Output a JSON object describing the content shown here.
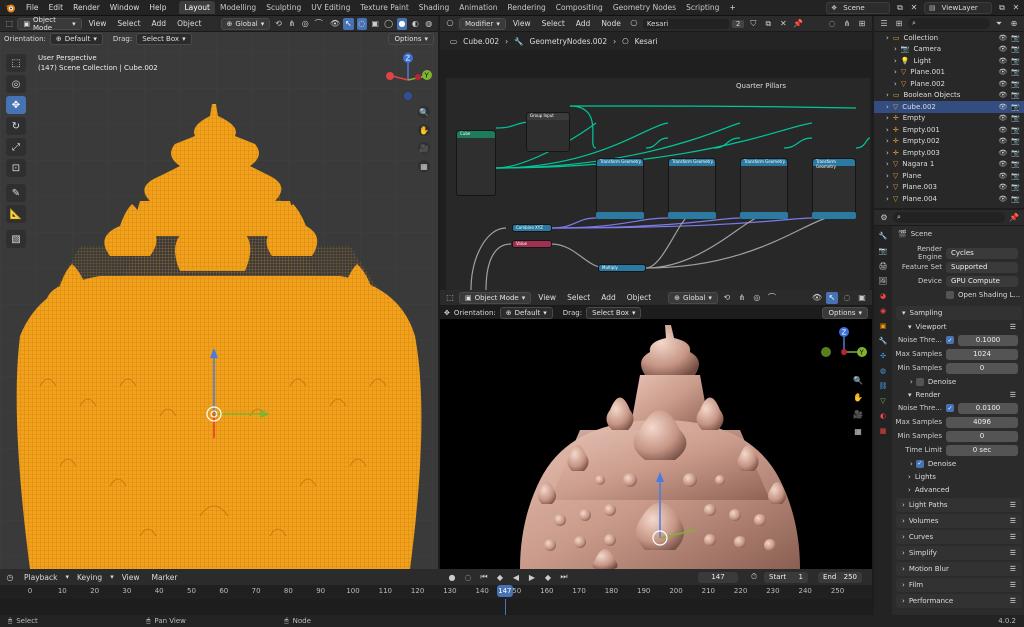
{
  "topbar": {
    "menus": [
      "File",
      "Edit",
      "Render",
      "Window",
      "Help"
    ],
    "workspaces": [
      "Layout",
      "Modelling",
      "Sculpting",
      "UV Editing",
      "Texture Paint",
      "Shading",
      "Animation",
      "Rendering",
      "Compositing",
      "Geometry Nodes",
      "Scripting"
    ],
    "add_tab": "+",
    "scene": "Scene",
    "view_layer": "ViewLayer"
  },
  "viewport1": {
    "mode": "Object Mode",
    "menus": [
      "View",
      "Select",
      "Add",
      "Object"
    ],
    "transform": "Global",
    "orientation_label": "Orientation:",
    "orientation_value": "Default",
    "drag_label": "Drag:",
    "drag_value": "Select Box",
    "options": "Options",
    "overlay_title": "User Perspective",
    "overlay_sub": "(147) Scene Collection | Cube.002"
  },
  "node_editor": {
    "editor": "Modifier",
    "menus": [
      "View",
      "Select",
      "Add",
      "Node"
    ],
    "tree_name": "Kesari",
    "users": "2",
    "crumbs": [
      "Cube.002",
      "GeometryNodes.002",
      "Kesari"
    ],
    "frame_label": "Quarter Pillars",
    "nodes": {
      "group_input": "Group Input",
      "cube": "Cube",
      "transform": "Transform Geometry",
      "combine": "Combine XYZ",
      "value": "Value",
      "multiply": "Multiply"
    }
  },
  "viewport2": {
    "mode": "Object Mode",
    "menus": [
      "View",
      "Select",
      "Add",
      "Object"
    ],
    "transform": "Global",
    "orientation_label": "Orientation:",
    "orientation_value": "Default",
    "drag_label": "Drag:",
    "drag_value": "Select Box",
    "options": "Options"
  },
  "outliner": {
    "rows": [
      {
        "name": "Collection",
        "indent": 1,
        "selected": false
      },
      {
        "name": "Camera",
        "indent": 2,
        "selected": false
      },
      {
        "name": "Light",
        "indent": 2,
        "selected": false
      },
      {
        "name": "Plane.001",
        "indent": 2,
        "selected": false
      },
      {
        "name": "Plane.002",
        "indent": 2,
        "selected": false
      },
      {
        "name": "Boolean Objects",
        "indent": 1,
        "selected": false
      },
      {
        "name": "Cube.002",
        "indent": 1,
        "selected": true
      },
      {
        "name": "Empty",
        "indent": 1,
        "selected": false
      },
      {
        "name": "Empty.001",
        "indent": 1,
        "selected": false
      },
      {
        "name": "Empty.002",
        "indent": 1,
        "selected": false
      },
      {
        "name": "Empty.003",
        "indent": 1,
        "selected": false
      },
      {
        "name": "Nagara 1",
        "indent": 1,
        "selected": false
      },
      {
        "name": "Plane",
        "indent": 1,
        "selected": false
      },
      {
        "name": "Plane.003",
        "indent": 1,
        "selected": false
      },
      {
        "name": "Plane.004",
        "indent": 1,
        "selected": false
      }
    ]
  },
  "properties": {
    "scene": "Scene",
    "render_engine_label": "Render Engine",
    "render_engine": "Cycles",
    "feature_set_label": "Feature Set",
    "feature_set": "Supported",
    "device_label": "Device",
    "device": "GPU Compute",
    "osl_label": "Open Shading L...",
    "sampling": "Sampling",
    "viewport": "Viewport",
    "noise_threshold_label": "Noise Thre...",
    "viewport_noise": "0.1000",
    "max_samples_label": "Max Samples",
    "viewport_max": "1024",
    "min_samples_label": "Min Samples",
    "viewport_min": "0",
    "denoise": "Denoise",
    "render": "Render",
    "render_noise": "0.0100",
    "render_max": "4096",
    "render_min": "0",
    "time_limit_label": "Time Limit",
    "time_limit": "0 sec",
    "render_denoise": "Denoise",
    "lights": "Lights",
    "advanced": "Advanced",
    "panels": [
      "Light Paths",
      "Volumes",
      "Curves",
      "Simplify",
      "Motion Blur",
      "Film",
      "Performance"
    ]
  },
  "timeline": {
    "menus": [
      "Playback",
      "Keying",
      "View",
      "Marker"
    ],
    "current_frame": "147",
    "start_label": "Start",
    "start": "1",
    "end_label": "End",
    "end": "250",
    "ticks": [
      "0",
      "10",
      "20",
      "30",
      "40",
      "50",
      "60",
      "70",
      "80",
      "90",
      "100",
      "110",
      "120",
      "130",
      "140",
      "150",
      "160",
      "170",
      "180",
      "190",
      "200",
      "210",
      "220",
      "230",
      "240",
      "250"
    ]
  },
  "status": {
    "select": "Select",
    "pan": "Pan View",
    "node": "Node",
    "version": "4.0.2"
  },
  "colors": {
    "accent": "#4772b3",
    "wire": "#f0a21f",
    "selected_row": "#334d80"
  }
}
